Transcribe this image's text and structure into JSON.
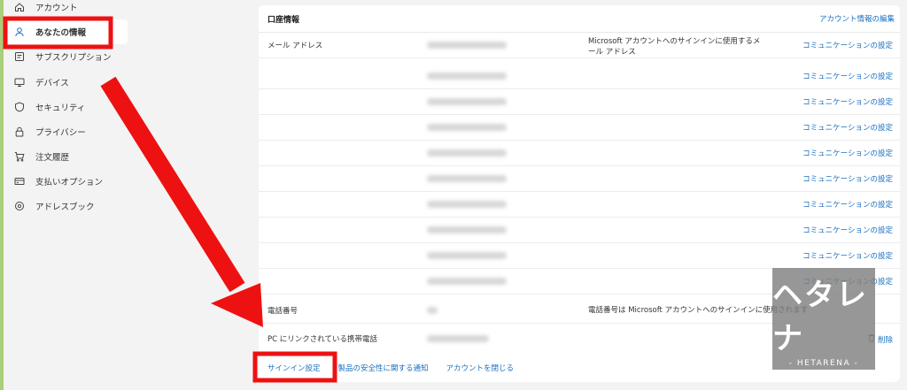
{
  "sidebar": {
    "items": [
      {
        "label": "アカウント",
        "icon": "home-icon"
      },
      {
        "label": "あなたの情報",
        "icon": "person-icon",
        "active": true
      },
      {
        "label": "サブスクリプション",
        "icon": "subscription-icon"
      },
      {
        "label": "デバイス",
        "icon": "monitor-icon"
      },
      {
        "label": "セキュリティ",
        "icon": "shield-icon"
      },
      {
        "label": "プライバシー",
        "icon": "lock-icon"
      },
      {
        "label": "注文履歴",
        "icon": "cart-icon"
      },
      {
        "label": "支払いオプション",
        "icon": "card-icon"
      },
      {
        "label": "アドレスブック",
        "icon": "location-pin-icon"
      }
    ]
  },
  "card": {
    "title": "口座情報",
    "edit_link": "アカウント情報の編集",
    "email_row": {
      "label": "メール アドレス",
      "description": "Microsoft アカウントへのサインインに使用するメール アドレス",
      "action": "コミュニケーションの設定"
    },
    "extra_rows": [
      {
        "action": "コミュニケーションの設定"
      },
      {
        "action": "コミュニケーションの設定"
      },
      {
        "action": "コミュニケーションの設定"
      },
      {
        "action": "コミュニケーションの設定"
      },
      {
        "action": "コミュニケーションの設定"
      },
      {
        "action": "コミュニケーションの設定"
      },
      {
        "action": "コミュニケーションの設定"
      },
      {
        "action": "コミュニケーションの設定"
      },
      {
        "action": "コミュニケーションの設定"
      }
    ],
    "phone_row": {
      "label": "電話番号",
      "description": "電話番号は Microsoft アカウントへのサインインに使用されます"
    },
    "linked_phone_row": {
      "label": "PC にリンクされている携帯電話",
      "action": "削除"
    },
    "footer_links": [
      "サインイン設定",
      "製品の安全性に関する通知",
      "アカウントを閉じる"
    ]
  },
  "watermark": {
    "logo": "ヘタレナ",
    "sub": "- HETARENA -"
  },
  "colors": {
    "accent_link": "#1a6fbf",
    "highlight_red": "#ee1111",
    "sidebar_strip": "#a9cf7a"
  }
}
